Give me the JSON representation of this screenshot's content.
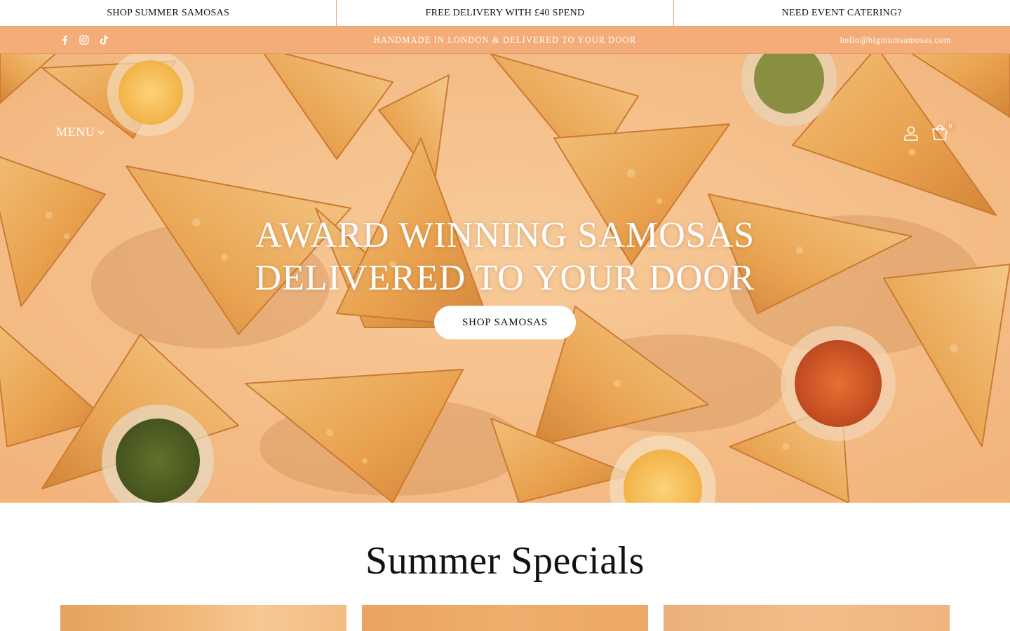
{
  "promo": [
    {
      "label": "SHOP SUMMER SAMOSAS"
    },
    {
      "label": "FREE DELIVERY WITH £40 SPEND"
    },
    {
      "label": "NEED EVENT CATERING?"
    }
  ],
  "info_bar": {
    "tagline": "HANDMADE IN LONDON & DELIVERED TO YOUR DOOR",
    "email": "hello@bigmumsamosas.com",
    "socials": [
      "facebook-icon",
      "instagram-icon",
      "tiktok-icon"
    ]
  },
  "header": {
    "menu_label": "MENU",
    "cart_count": "0"
  },
  "hero": {
    "title_line1": "AWARD WINNING SAMOSAS",
    "title_line2": "DELIVERED TO YOUR DOOR",
    "cta_label": "SHOP SAMOSAS"
  },
  "specials": {
    "title": "Summer Specials"
  },
  "colors": {
    "accent": "#f4ad78",
    "hero_bg": "#f6c08d",
    "text": "#111111"
  }
}
